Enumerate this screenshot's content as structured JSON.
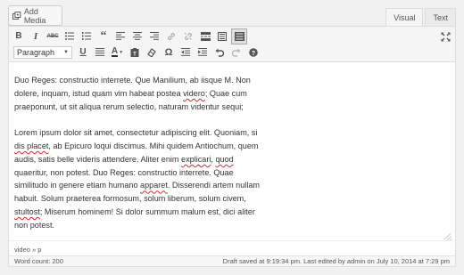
{
  "top": {
    "add_media_label": "Add Media",
    "tabs": [
      "Visual",
      "Text"
    ]
  },
  "toolbar": {
    "row1_icons": [
      "bold-icon",
      "italic-icon",
      "strikethrough-icon",
      "bulleted-list-icon",
      "numbered-list-icon",
      "blockquote-icon",
      "align-left-icon",
      "align-center-icon",
      "align-right-icon",
      "insert-link-icon",
      "remove-link-icon",
      "read-more-icon",
      "fullscreen-icon",
      "kitchen-sink-icon"
    ],
    "format_select_value": "Paragraph",
    "row2_icons": [
      "underline-icon",
      "justify-icon",
      "text-color-icon",
      "paste-as-text-icon",
      "clear-formatting-icon",
      "special-character-icon",
      "outdent-icon",
      "indent-icon",
      "undo-icon",
      "redo-icon",
      "help-icon"
    ]
  },
  "content": {
    "p1_lines": [
      "Duo Reges: constructio interrete. Que Manilium, ab iisque M. Non",
      "dolere, inquam, istud quam vim habeat postea videro; Quae cum",
      "praeponunt, ut sit aliqua rerum selectio, naturam videntur sequi;"
    ],
    "p2_lines": [
      "Lorem ipsum dolor sit amet, consectetur adipiscing elit. Quoniam, si",
      "dis placet, ab Epicuro loqui discimus. Mihi quidem Antiochum, quem",
      "audis, satis belle videris attendere. Aliter enim explicari, quod",
      "quaeritur, non potest. Duo Reges: constructio interrete. Quae",
      "similitudo in genere etiam humano apparet. Disserendi artem nullam",
      "habuit. Solum praeterea formosum, solum liberum, solum civem,",
      "stultost; Miserum hominem! Si dolor summum malum est, dici aliter",
      "non potest."
    ]
  },
  "path_bar": "video » p",
  "status": {
    "word_count": "Word count: 200",
    "draft_info": "Draft saved at 9:19:34 pm. Last edited by admin on July 10, 2014 at 7:29 pm"
  },
  "colors": {
    "spellcheck_underline": "#dd2233"
  }
}
